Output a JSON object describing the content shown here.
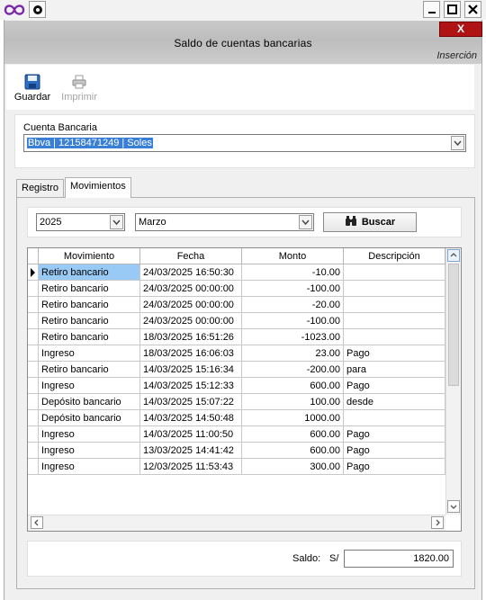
{
  "window": {
    "title": "Saldo de cuentas bancarias",
    "mode": "Inserción",
    "close_label": "X"
  },
  "toolbar": {
    "save_label": "Guardar",
    "print_label": "Imprimir"
  },
  "account": {
    "label": "Cuenta Bancaria",
    "value": "Bbva  |  12158471249  |  Soles"
  },
  "tabs": [
    {
      "label": "Registro"
    },
    {
      "label": "Movimientos"
    }
  ],
  "filters": {
    "year": "2025",
    "month": "Marzo",
    "search_label": "Buscar"
  },
  "grid": {
    "columns": [
      "Movimiento",
      "Fecha",
      "Monto",
      "Descripción"
    ],
    "rows": [
      {
        "movimiento": "Retiro bancario",
        "fecha": "24/03/2025 16:50:30",
        "monto": "-10.00",
        "descripcion": ""
      },
      {
        "movimiento": "Retiro bancario",
        "fecha": "24/03/2025 00:00:00",
        "monto": "-100.00",
        "descripcion": ""
      },
      {
        "movimiento": "Retiro bancario",
        "fecha": "24/03/2025 00:00:00",
        "monto": "-20.00",
        "descripcion": ""
      },
      {
        "movimiento": "Retiro bancario",
        "fecha": "24/03/2025 00:00:00",
        "monto": "-100.00",
        "descripcion": ""
      },
      {
        "movimiento": "Retiro bancario",
        "fecha": "18/03/2025 16:51:26",
        "monto": "-1023.00",
        "descripcion": ""
      },
      {
        "movimiento": "Ingreso",
        "fecha": "18/03/2025 16:06:03",
        "monto": "23.00",
        "descripcion": "Pago"
      },
      {
        "movimiento": "Retiro bancario",
        "fecha": "14/03/2025 15:16:34",
        "monto": "-200.00",
        "descripcion": "para"
      },
      {
        "movimiento": "Ingreso",
        "fecha": "14/03/2025 15:12:33",
        "monto": "600.00",
        "descripcion": "Pago"
      },
      {
        "movimiento": "Depósito bancario",
        "fecha": "14/03/2025 15:07:22",
        "monto": "100.00",
        "descripcion": "desde"
      },
      {
        "movimiento": "Depósito bancario",
        "fecha": "14/03/2025 14:50:48",
        "monto": "1000.00",
        "descripcion": ""
      },
      {
        "movimiento": "Ingreso",
        "fecha": "14/03/2025 11:00:50",
        "monto": "600.00",
        "descripcion": "Pago"
      },
      {
        "movimiento": "Ingreso",
        "fecha": "13/03/2025 14:41:42",
        "monto": "600.00",
        "descripcion": "Pago"
      },
      {
        "movimiento": "Ingreso",
        "fecha": "12/03/2025 11:53:43",
        "monto": "300.00",
        "descripcion": "Pago"
      }
    ]
  },
  "footer": {
    "saldo_label": "Saldo:",
    "currency": "S/",
    "saldo_value": "1820.00"
  }
}
